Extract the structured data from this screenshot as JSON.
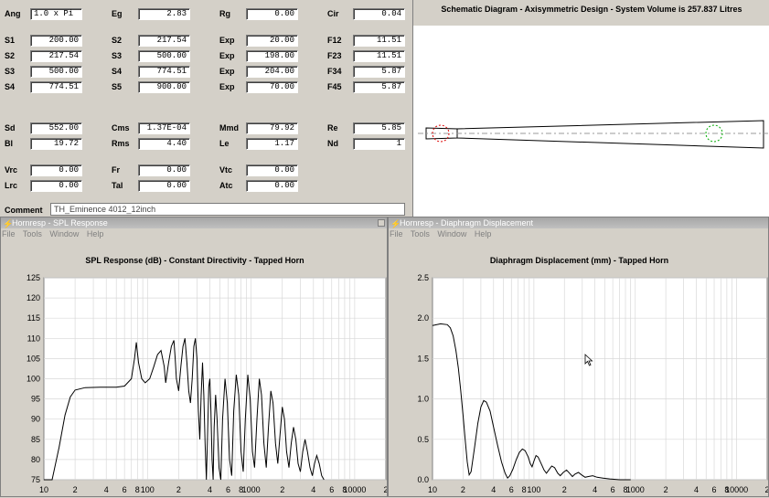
{
  "params": [
    {
      "name": "ang",
      "label": "Ang",
      "value": "1.0 x Pi",
      "left": true
    },
    {
      "name": "eg",
      "label": "Eg",
      "value": "2.83"
    },
    {
      "name": "rg",
      "label": "Rg",
      "value": "0.00"
    },
    {
      "name": "cir",
      "label": "Cir",
      "value": "0.04"
    },
    {
      "name": "s1",
      "label": "S1",
      "value": "200.00"
    },
    {
      "name": "s2b",
      "label": "S2",
      "value": "217.54"
    },
    {
      "name": "exp1",
      "label": "Exp",
      "value": "20.00"
    },
    {
      "name": "f12",
      "label": "F12",
      "value": "11.51"
    },
    {
      "name": "s2",
      "label": "S2",
      "value": "217.54"
    },
    {
      "name": "s3b",
      "label": "S3",
      "value": "500.00"
    },
    {
      "name": "exp2",
      "label": "Exp",
      "value": "198.00"
    },
    {
      "name": "f23",
      "label": "F23",
      "value": "11.51"
    },
    {
      "name": "s3",
      "label": "S3",
      "value": "500.00"
    },
    {
      "name": "s4b",
      "label": "S4",
      "value": "774.51"
    },
    {
      "name": "exp3",
      "label": "Exp",
      "value": "204.00"
    },
    {
      "name": "f34",
      "label": "F34",
      "value": "5.87"
    },
    {
      "name": "s4",
      "label": "S4",
      "value": "774.51"
    },
    {
      "name": "s5",
      "label": "S5",
      "value": "900.00"
    },
    {
      "name": "exp4",
      "label": "Exp",
      "value": "70.00"
    },
    {
      "name": "f45",
      "label": "F45",
      "value": "5.87"
    },
    {
      "name": "sd",
      "label": "Sd",
      "value": "552.00"
    },
    {
      "name": "cms",
      "label": "Cms",
      "value": "1.37E-04"
    },
    {
      "name": "mmd",
      "label": "Mmd",
      "value": "79.92"
    },
    {
      "name": "re",
      "label": "Re",
      "value": "5.85"
    },
    {
      "name": "bl",
      "label": "Bl",
      "value": "19.72"
    },
    {
      "name": "rms",
      "label": "Rms",
      "value": "4.40"
    },
    {
      "name": "le",
      "label": "Le",
      "value": "1.17"
    },
    {
      "name": "nd",
      "label": "Nd",
      "value": "1"
    },
    {
      "name": "vrc",
      "label": "Vrc",
      "value": "0.00"
    },
    {
      "name": "fr",
      "label": "Fr",
      "value": "0.00"
    },
    {
      "name": "vtc",
      "label": "Vtc",
      "value": "0.00"
    },
    {
      "name": "lrc",
      "label": "Lrc",
      "value": "0.00"
    },
    {
      "name": "tal",
      "label": "Tal",
      "value": "0.00"
    },
    {
      "name": "atc",
      "label": "Atc",
      "value": "0.00"
    }
  ],
  "comment": {
    "label": "Comment",
    "value": "TH_Eminence 4012_12inch"
  },
  "schematic": {
    "title": "Schematic Diagram - Axisymmetric Design - System Volume is 257.837 Litres"
  },
  "spl_window": {
    "title": "Hornresp - SPL Response",
    "menu": [
      "File",
      "Tools",
      "Window",
      "Help"
    ],
    "plot_title": "SPL Response (dB) - Constant Directivity - Tapped Horn"
  },
  "disp_window": {
    "title": "Hornresp - Diaphragm Displacement",
    "menu": [
      "File",
      "Tools",
      "Window",
      "Help"
    ],
    "plot_title": "Diaphragm Displacement (mm) - Tapped Horn"
  },
  "chart_data": [
    {
      "type": "line",
      "title": "SPL Response (dB) - Constant Directivity - Tapped Horn",
      "xscale": "log",
      "xlim": [
        10,
        20000
      ],
      "ylim": [
        75,
        125
      ],
      "xticks": [
        "10",
        "2",
        "4",
        "6",
        "8",
        "100",
        "2",
        "4",
        "6",
        "8",
        "1000",
        "2",
        "4",
        "6",
        "8",
        "10000",
        "2"
      ],
      "yticks": [
        "75",
        "80",
        "85",
        "90",
        "95",
        "100",
        "105",
        "110",
        "115",
        "120",
        "125"
      ],
      "grid": true,
      "series": [
        {
          "color": "#000000",
          "points": [
            [
              10,
              70
            ],
            [
              12,
              75
            ],
            [
              14,
              83
            ],
            [
              16,
              91
            ],
            [
              18,
              95.5
            ],
            [
              20,
              97.2
            ],
            [
              25,
              97.8
            ],
            [
              35,
              97.9
            ],
            [
              50,
              97.9
            ],
            [
              60,
              98.2
            ],
            [
              70,
              100
            ],
            [
              75,
              105
            ],
            [
              78,
              109
            ],
            [
              82,
              104
            ],
            [
              88,
              100
            ],
            [
              95,
              99
            ],
            [
              105,
              100
            ],
            [
              115,
              103
            ],
            [
              125,
              106
            ],
            [
              135,
              107
            ],
            [
              145,
              103
            ],
            [
              150,
              99
            ],
            [
              160,
              104
            ],
            [
              170,
              108
            ],
            [
              180,
              109.5
            ],
            [
              185,
              105
            ],
            [
              190,
              100
            ],
            [
              200,
              97
            ],
            [
              210,
              103
            ],
            [
              220,
              108
            ],
            [
              230,
              110
            ],
            [
              240,
              104
            ],
            [
              250,
              97
            ],
            [
              260,
              94
            ],
            [
              270,
              100
            ],
            [
              280,
              108
            ],
            [
              290,
              110
            ],
            [
              300,
              105
            ],
            [
              310,
              92
            ],
            [
              320,
              85
            ],
            [
              330,
              96
            ],
            [
              340,
              104
            ],
            [
              350,
              96
            ],
            [
              360,
              84
            ],
            [
              370,
              75
            ],
            [
              380,
              86
            ],
            [
              390,
              98
            ],
            [
              400,
              100
            ],
            [
              410,
              92
            ],
            [
              420,
              80
            ],
            [
              430,
              75
            ],
            [
              440,
              88
            ],
            [
              455,
              96
            ],
            [
              470,
              90
            ],
            [
              490,
              78
            ],
            [
              510,
              75
            ],
            [
              530,
              90
            ],
            [
              560,
              100
            ],
            [
              590,
              94
            ],
            [
              620,
              80
            ],
            [
              650,
              76
            ],
            [
              680,
              92
            ],
            [
              720,
              101
            ],
            [
              760,
              96
            ],
            [
              800,
              82
            ],
            [
              840,
              77
            ],
            [
              880,
              90
            ],
            [
              930,
              101
            ],
            [
              980,
              95
            ],
            [
              1030,
              82
            ],
            [
              1080,
              78
            ],
            [
              1140,
              90
            ],
            [
              1200,
              100
            ],
            [
              1260,
              96
            ],
            [
              1330,
              84
            ],
            [
              1400,
              78
            ],
            [
              1470,
              88
            ],
            [
              1550,
              97
            ],
            [
              1630,
              94
            ],
            [
              1720,
              84
            ],
            [
              1810,
              79
            ],
            [
              1900,
              86
            ],
            [
              2000,
              93
            ],
            [
              2100,
              90
            ],
            [
              2200,
              82
            ],
            [
              2320,
              78
            ],
            [
              2440,
              84
            ],
            [
              2570,
              88
            ],
            [
              2700,
              85
            ],
            [
              2840,
              79
            ],
            [
              2990,
              77
            ],
            [
              3150,
              82
            ],
            [
              3320,
              85
            ],
            [
              3500,
              82
            ],
            [
              3700,
              78
            ],
            [
              3900,
              76
            ],
            [
              4100,
              79
            ],
            [
              4300,
              81
            ],
            [
              4550,
              79
            ],
            [
              4800,
              76
            ],
            [
              5050,
              75
            ]
          ]
        }
      ]
    },
    {
      "type": "line",
      "title": "Diaphragm Displacement (mm) - Tapped Horn",
      "xscale": "log",
      "xlim": [
        10,
        20000
      ],
      "ylim": [
        0,
        2.5
      ],
      "xticks": [
        "10",
        "2",
        "4",
        "6",
        "8",
        "100",
        "2",
        "4",
        "6",
        "8",
        "1000",
        "2",
        "4",
        "6",
        "8",
        "10000",
        "2"
      ],
      "yticks": [
        "0.0",
        "0.5",
        "1.0",
        "1.5",
        "2.0",
        "2.5"
      ],
      "grid": true,
      "series": [
        {
          "color": "#000000",
          "points": [
            [
              10,
              1.91
            ],
            [
              12,
              1.93
            ],
            [
              14,
              1.92
            ],
            [
              15,
              1.88
            ],
            [
              16,
              1.78
            ],
            [
              17,
              1.6
            ],
            [
              18,
              1.38
            ],
            [
              19,
              1.1
            ],
            [
              20,
              0.8
            ],
            [
              21,
              0.5
            ],
            [
              22,
              0.22
            ],
            [
              23,
              0.06
            ],
            [
              24,
              0.1
            ],
            [
              26,
              0.4
            ],
            [
              28,
              0.7
            ],
            [
              30,
              0.9
            ],
            [
              32,
              0.98
            ],
            [
              34,
              0.96
            ],
            [
              37,
              0.85
            ],
            [
              40,
              0.65
            ],
            [
              44,
              0.42
            ],
            [
              48,
              0.22
            ],
            [
              52,
              0.08
            ],
            [
              55,
              0.02
            ],
            [
              58,
              0.05
            ],
            [
              62,
              0.13
            ],
            [
              67,
              0.25
            ],
            [
              72,
              0.34
            ],
            [
              77,
              0.38
            ],
            [
              82,
              0.36
            ],
            [
              88,
              0.28
            ],
            [
              92,
              0.2
            ],
            [
              96,
              0.16
            ],
            [
              100,
              0.23
            ],
            [
              105,
              0.3
            ],
            [
              110,
              0.28
            ],
            [
              118,
              0.2
            ],
            [
              126,
              0.12
            ],
            [
              133,
              0.08
            ],
            [
              140,
              0.12
            ],
            [
              150,
              0.17
            ],
            [
              160,
              0.15
            ],
            [
              172,
              0.08
            ],
            [
              182,
              0.05
            ],
            [
              195,
              0.09
            ],
            [
              210,
              0.12
            ],
            [
              225,
              0.08
            ],
            [
              240,
              0.04
            ],
            [
              255,
              0.07
            ],
            [
              275,
              0.09
            ],
            [
              295,
              0.06
            ],
            [
              320,
              0.03
            ],
            [
              345,
              0.04
            ],
            [
              380,
              0.05
            ],
            [
              420,
              0.03
            ],
            [
              480,
              0.02
            ],
            [
              560,
              0.01
            ],
            [
              700,
              0.0
            ],
            [
              900,
              0.0
            ]
          ]
        }
      ]
    }
  ]
}
